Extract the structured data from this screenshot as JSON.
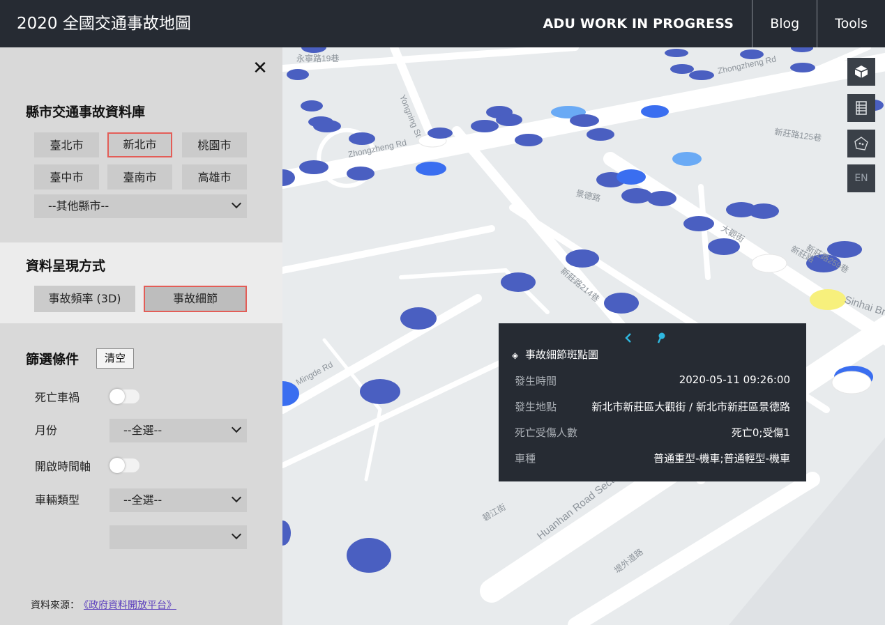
{
  "header": {
    "title": "2020 全國交通事故地圖",
    "site": "ADU WORK IN PROGRESS",
    "links": [
      "Blog",
      "Tools"
    ]
  },
  "sidebar": {
    "close_glyph": "✕",
    "database": {
      "title": "縣市交通事故資料庫",
      "cities": [
        "臺北市",
        "新北市",
        "桃園市",
        "臺中市",
        "臺南市",
        "高雄市"
      ],
      "selected_city": "新北市",
      "other_select": "--其他縣市--"
    },
    "mode": {
      "title": "資料呈現方式",
      "options": [
        "事故頻率 (3D)",
        "事故細節"
      ],
      "selected": "事故細節"
    },
    "filter": {
      "title": "篩選條件",
      "clear_label": "清空",
      "fatal_label": "死亡車禍",
      "fatal_on": false,
      "month_label": "月份",
      "month_value": "--全選--",
      "timeline_label": "開啟時間軸",
      "timeline_on": false,
      "vehicle_label": "車輛類型",
      "vehicle_value": "--全選--",
      "vehicle_sub_value": ""
    },
    "source_label": "資料來源：",
    "source_link": "《政府資料開放平台》"
  },
  "map": {
    "road_labels": [
      "Zhongzheng Rd",
      "Zhongzheng Rd",
      "Yongning St",
      "新莊路125巷",
      "景德路",
      "大觀街",
      "新莊路",
      "新莊路214巷",
      "新莊路259巷",
      "Sinhai Bridge",
      "Mingde Rd",
      "碧江街",
      "Huanhan Road Section",
      "堤外道路",
      "永寧路19巷"
    ],
    "controls": [
      "3d-view-icon",
      "table-icon",
      "polygon-select-icon"
    ],
    "lang_button": "EN"
  },
  "popup": {
    "title": "事故細節斑點圖",
    "rows": [
      {
        "key": "發生時間",
        "value": "2020-05-11 09:26:00"
      },
      {
        "key": "發生地點",
        "value": "新北市新莊區大觀街 / 新北市新莊區景德路"
      },
      {
        "key": "死亡受傷人數",
        "value": "死亡0;受傷1"
      },
      {
        "key": "車種",
        "value": "普通重型-機車;普通輕型-機車"
      }
    ]
  },
  "colors": {
    "header_bg": "#262b33",
    "dot_blue": "#4a5fc1",
    "dot_bright": "#3a6ef0",
    "dot_white": "#ffffff",
    "dot_yellow": "#f7f07c",
    "selected_border": "#e35d57",
    "accent_cyan": "#2fb8e0"
  }
}
